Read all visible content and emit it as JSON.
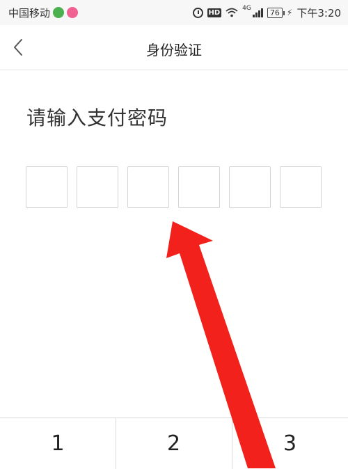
{
  "status_bar": {
    "carrier": "中国移动",
    "network_label": "4G",
    "battery_level": "76",
    "time": "下午3:20",
    "hd_label": "HD"
  },
  "nav": {
    "title": "身份验证",
    "back_icon": "chevron-left-icon"
  },
  "main": {
    "heading": "请输入支付密码",
    "pin_length": 6,
    "pin_digits_entered": 0
  },
  "keypad": {
    "keys": [
      "1",
      "2",
      "3"
    ]
  },
  "annotation": {
    "arrow_color": "#f2211b"
  }
}
